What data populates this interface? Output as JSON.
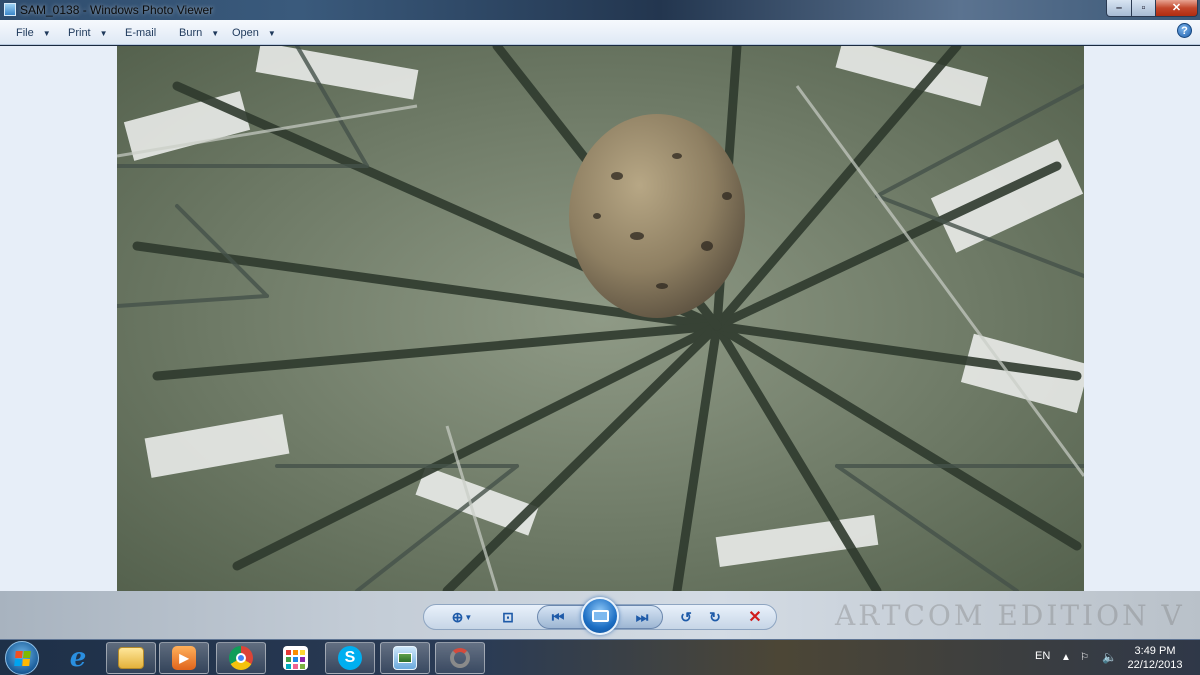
{
  "window": {
    "title": "SAM_0138 - Windows Photo Viewer",
    "controls": {
      "minimize": "–",
      "maximize": "▫",
      "close": "✕"
    }
  },
  "menubar": {
    "items": [
      {
        "label": "File",
        "has_dropdown": true
      },
      {
        "label": "Print",
        "has_dropdown": true
      },
      {
        "label": "E-mail",
        "has_dropdown": false
      },
      {
        "label": "Burn",
        "has_dropdown": true
      },
      {
        "label": "Open",
        "has_dropdown": true
      }
    ],
    "help_icon": "?"
  },
  "photo": {
    "subject": "hornet nest on palm fronds"
  },
  "controls": {
    "zoom_icon": "zoom-icon",
    "actual_size_icon": "fit-to-window-icon",
    "previous_icon": "previous-icon",
    "slideshow_icon": "slideshow-icon",
    "next_icon": "next-icon",
    "rotate_ccw_icon": "rotate-counterclockwise-icon",
    "rotate_cw_icon": "rotate-clockwise-icon",
    "delete_icon": "delete-icon",
    "watermark": "ARTCOM EDITION V"
  },
  "taskbar": {
    "apps": [
      "internet-explorer",
      "windows-explorer",
      "media-player",
      "chrome",
      "apps-launcher",
      "skype",
      "windows-photo-viewer",
      "other-app"
    ],
    "language": "EN",
    "time": "3:49 PM",
    "date": "22/12/2013"
  },
  "colors": {
    "menu_text": "#1e395b",
    "close_button": "#c3462b",
    "delete_red": "#d11c1c",
    "accent_blue": "#1e5aa8"
  }
}
